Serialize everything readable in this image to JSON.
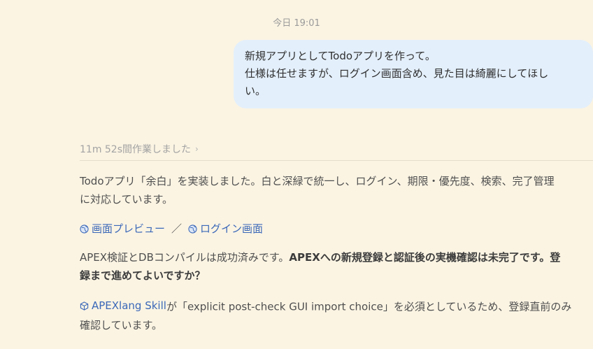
{
  "timestamp": "今日 19:01",
  "user_message": {
    "line1": "新規アプリとしてTodoアプリを作って。",
    "line2": "仕様は任せますが、ログイン画面含め、見た目は綺麗にしてほし",
    "line3": "い。"
  },
  "work_summary": {
    "label": "11m 52s間作業しました",
    "chevron": "›"
  },
  "response": {
    "p1_line1": "Todoアプリ「余白」を実装しました。白と深緑で統一し、ログイン、期限・優先度、検索、完了管理",
    "p1_line2": "に対応しています。",
    "links": {
      "preview": "画面プレビュー",
      "separator": "／",
      "login": "ログイン画面",
      "icon": "globe-icon"
    },
    "p3_plain": "APEX検証とDBコンパイルは成功済みです。",
    "p3_bold_line1": "APEXへの新規登録と認証後の実機確認は未完了です。登",
    "p3_bold_line2": "録まで進めてよいですか？",
    "p4_skill": "APEXlang Skill",
    "p4_rest_line1": "が「explicit post-check GUI import choice」を必須としているため、登録直前のみ",
    "p4_rest_line2": "確認しています。"
  },
  "colors": {
    "background": "#fbf4e3",
    "user_bubble": "#e3effb",
    "link": "#3b68b8"
  }
}
